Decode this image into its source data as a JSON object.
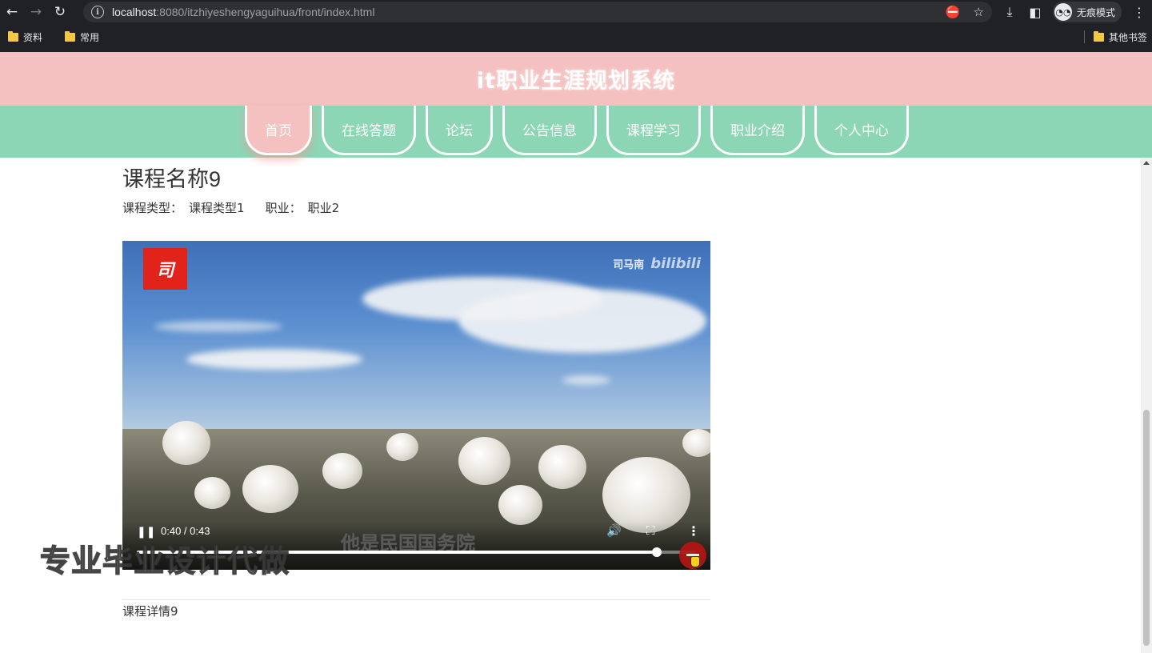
{
  "browser": {
    "url_host": "localhost",
    "url_rest": ":8080/itzhiyeshengyaguihua/front/index.html",
    "incognito_label": "无痕模式",
    "bookmarks": [
      {
        "label": "资料"
      },
      {
        "label": "常用"
      }
    ],
    "other_bookmarks": "其他书签"
  },
  "site": {
    "title": "it职业生涯规划系统",
    "nav": [
      {
        "label": "首页",
        "active": true
      },
      {
        "label": "在线答题",
        "active": false
      },
      {
        "label": "论坛",
        "active": false
      },
      {
        "label": "公告信息",
        "active": false
      },
      {
        "label": "课程学习",
        "active": false
      },
      {
        "label": "职业介绍",
        "active": false
      },
      {
        "label": "个人中心",
        "active": false
      }
    ]
  },
  "course": {
    "name": "课程名称9",
    "type_label": "课程类型：",
    "type_value": "课程类型1",
    "job_label": "职业：",
    "job_value": "职业2",
    "detail": "课程详情9"
  },
  "video": {
    "time": "0:40 / 0:43",
    "progress": 0.93,
    "badge_text": "司",
    "watermark_name": "司马南",
    "watermark_brand": "bilibili",
    "subtitle": "他是民国国务院"
  },
  "overlay_ad": "专业毕业设计代做",
  "colors": {
    "header_bg": "#f5c0c0",
    "nav_bg": "#8cd6b6"
  }
}
